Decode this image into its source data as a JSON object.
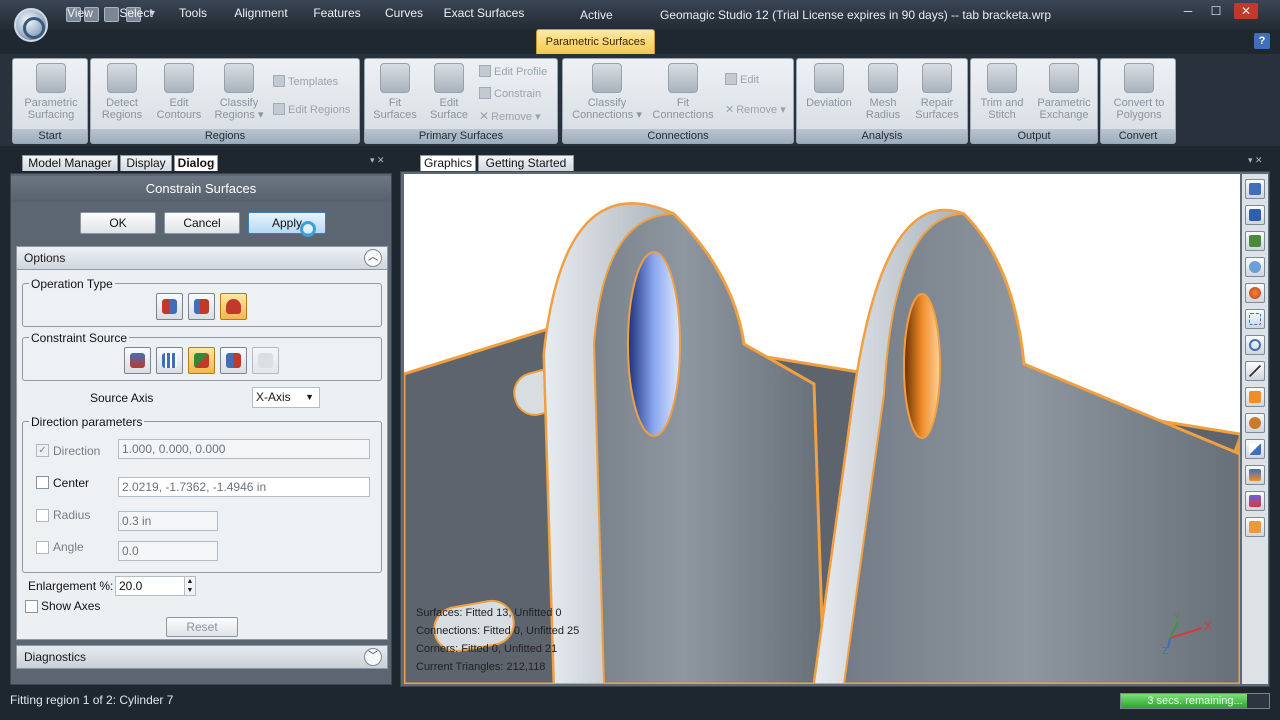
{
  "window": {
    "context_label": "Active",
    "title": "Geomagic Studio 12 (Trial License expires in 90 days) -- tab bracketa.wrp",
    "minimize": "─",
    "maximize": "☐",
    "close": "✕"
  },
  "menu": {
    "tabs": [
      "View",
      "Select",
      "Tools",
      "Alignment",
      "Features",
      "Curves",
      "Exact Surfaces",
      "Parametric Surfaces"
    ],
    "active": "Parametric Surfaces",
    "help": "?"
  },
  "ribbon": {
    "groups": [
      {
        "label": "Start",
        "buttons": [
          {
            "label": "Parametric\nSurfacing",
            "icon": "parametric-surfacing-icon"
          }
        ]
      },
      {
        "label": "Regions",
        "buttons": [
          {
            "label": "Detect\nRegions"
          },
          {
            "label": "Edit\nContours"
          },
          {
            "label": "Classify\nRegions ▾"
          }
        ],
        "small": [
          "Templates",
          "Edit Regions"
        ]
      },
      {
        "label": "Primary Surfaces",
        "buttons": [
          {
            "label": "Fit\nSurfaces"
          },
          {
            "label": "Edit\nSurface"
          }
        ],
        "small": [
          "Edit Profile",
          "Constrain",
          "Remove ▾"
        ]
      },
      {
        "label": "Connections",
        "buttons": [
          {
            "label": "Classify\nConnections ▾"
          },
          {
            "label": "Fit\nConnections"
          }
        ],
        "small": [
          "Edit",
          "Remove ▾"
        ]
      },
      {
        "label": "Analysis",
        "buttons": [
          {
            "label": "Deviation"
          },
          {
            "label": "Mesh\nRadius"
          },
          {
            "label": "Repair\nSurfaces"
          }
        ]
      },
      {
        "label": "Output",
        "buttons": [
          {
            "label": "Trim and\nStitch"
          },
          {
            "label": "Parametric\nExchange"
          }
        ]
      },
      {
        "label": "Convert",
        "buttons": [
          {
            "label": "Convert to\nPolygons"
          }
        ]
      }
    ]
  },
  "left_tabs": [
    "Model Manager",
    "Display",
    "Dialog"
  ],
  "left_tab_active": "Dialog",
  "right_tabs": [
    "Graphics",
    "Getting Started"
  ],
  "dialog": {
    "title": "Constrain Surfaces",
    "ok": "OK",
    "cancel": "Cancel",
    "apply": "Apply",
    "options_header": "Options",
    "operation_type_label": "Operation Type",
    "constraint_source_label": "Constraint Source",
    "source_axis_label": "Source Axis",
    "source_axis_value": "X-Axis",
    "direction_params_label": "Direction parameters",
    "direction": {
      "label": "Direction",
      "checked": true,
      "value": "1.000, 0.000, 0.000"
    },
    "center": {
      "label": "Center",
      "checked": false,
      "value": "2.0219, -1.7362, -1.4946 in"
    },
    "radius": {
      "label": "Radius",
      "checked": false,
      "value": "0.3 in"
    },
    "angle": {
      "label": "Angle",
      "checked": false,
      "value": "0.0"
    },
    "enlargement_label": "Enlargement %:",
    "enlargement_value": "20.0",
    "show_axes_label": "Show Axes",
    "reset": "Reset",
    "diagnostics_header": "Diagnostics"
  },
  "viewport": {
    "stats": [
      "Surfaces: Fitted 13, Unfitted 0",
      "Connections: Fitted 0, Unfitted 25",
      "Corners: Fitted 0, Unfitted 21",
      "Current Triangles: 212,118"
    ],
    "axis_x": "X",
    "axis_y": "Y",
    "axis_z": "Z"
  },
  "status": {
    "text": "Fitting region 1 of 2: Cylinder 7",
    "progress_text": "3 secs. remaining...",
    "progress_fraction": 0.85
  },
  "colors": {
    "accent": "#f4b84a",
    "highlight_orange": "#f08c2a",
    "viewport_blue": "#6b8fd8"
  }
}
